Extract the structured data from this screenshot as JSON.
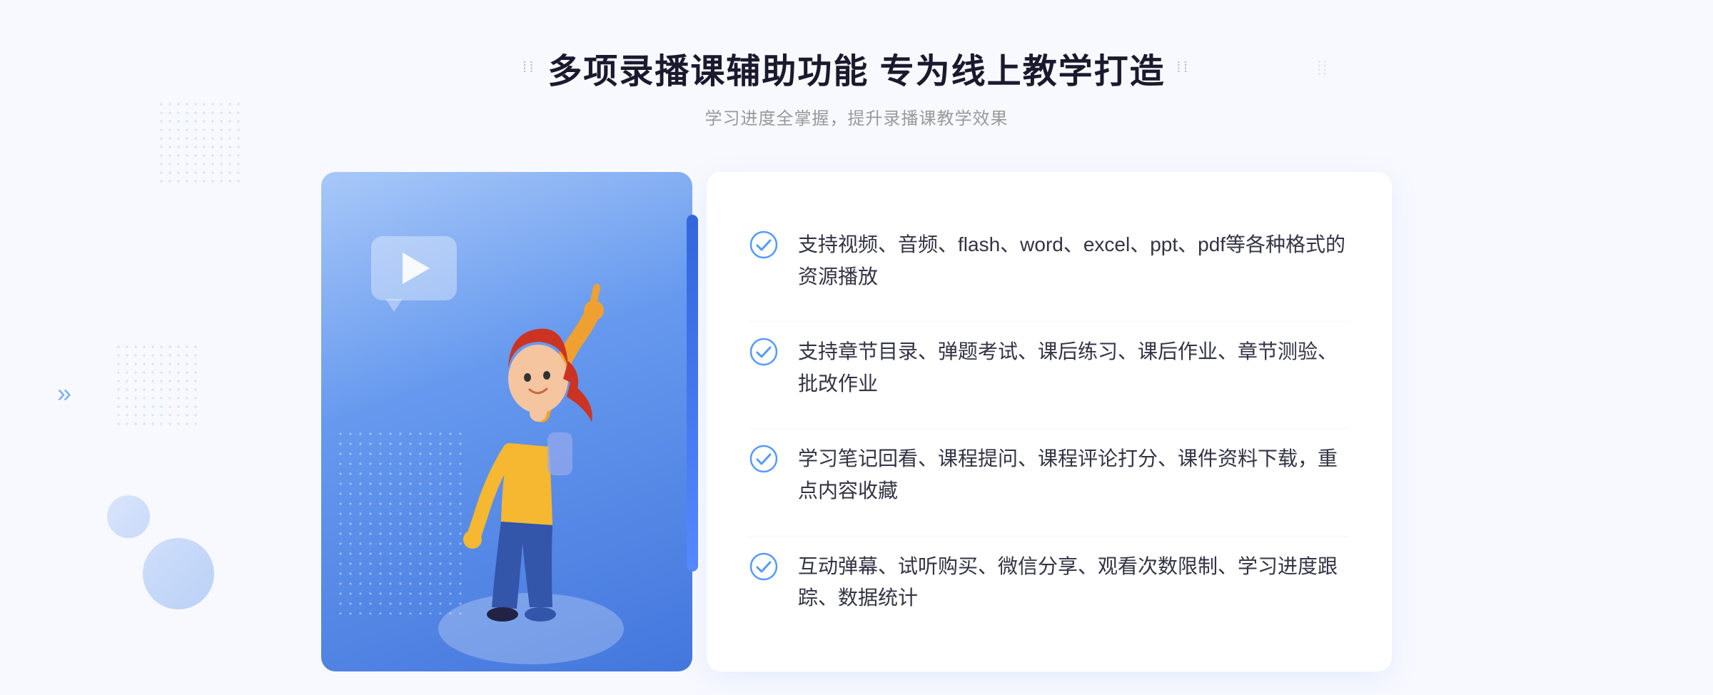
{
  "header": {
    "decorator_dots_left": "⁞⁞",
    "decorator_dots_right": "⁞⁞",
    "main_title": "多项录播课辅助功能 专为线上教学打造",
    "sub_title": "学习进度全掌握，提升录播课教学效果"
  },
  "features": [
    {
      "id": 1,
      "text": "支持视频、音频、flash、word、excel、ppt、pdf等各种格式的资源播放"
    },
    {
      "id": 2,
      "text": "支持章节目录、弹题考试、课后练习、课后作业、章节测验、批改作业"
    },
    {
      "id": 3,
      "text": "学习笔记回看、课程提问、课程评论打分、课件资料下载，重点内容收藏"
    },
    {
      "id": 4,
      "text": "互动弹幕、试听购买、微信分享、观看次数限制、学习进度跟踪、数据统计"
    }
  ],
  "colors": {
    "accent_blue": "#4d8ef5",
    "light_blue": "#a8c4f5",
    "title_color": "#1a1a2e",
    "sub_color": "#999999",
    "text_color": "#333344",
    "check_color": "#5599ff"
  }
}
